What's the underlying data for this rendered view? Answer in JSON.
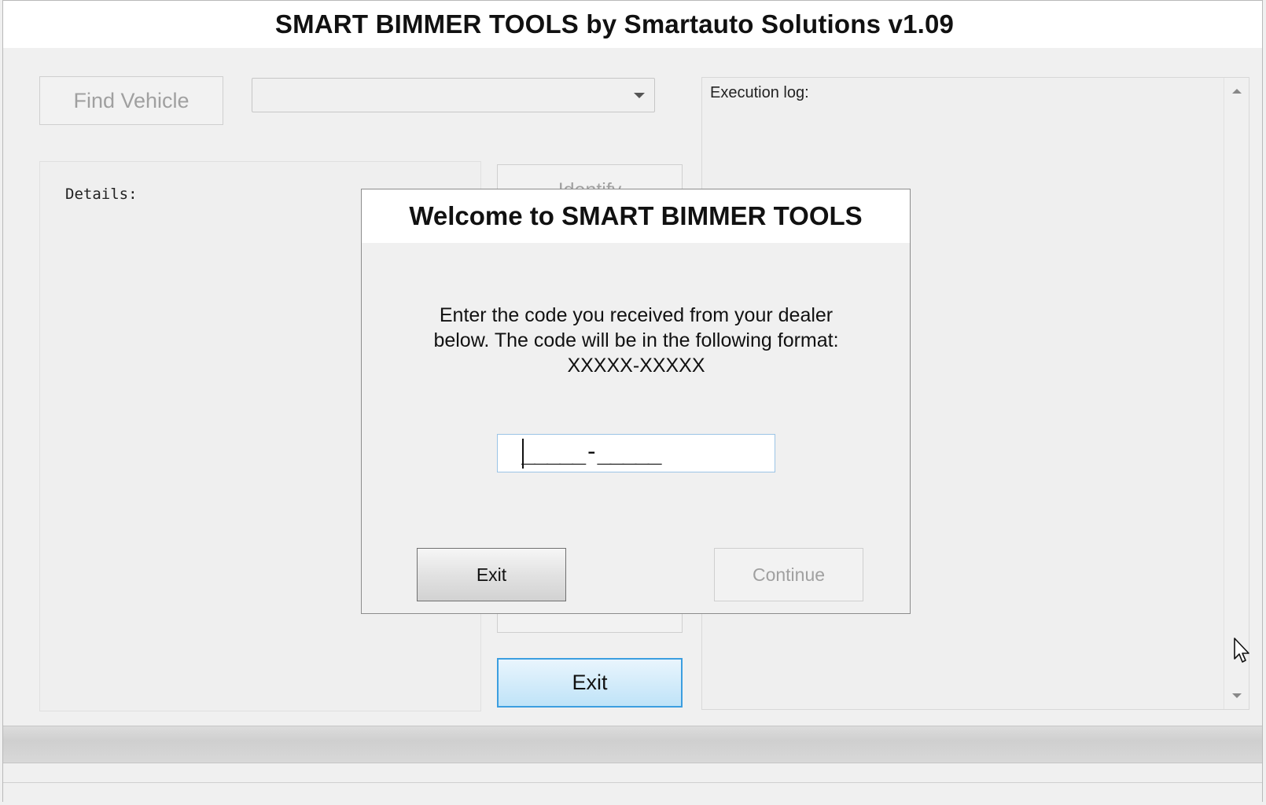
{
  "window": {
    "title": "SMART BIMMER TOOLS by Smartauto Solutions v1.09"
  },
  "toolbar": {
    "find_vehicle_label": "Find Vehicle",
    "vehicle_select_value": ""
  },
  "details": {
    "label": "Details:"
  },
  "actions": {
    "identify_label": "Identify",
    "exit_label": "Exit"
  },
  "log": {
    "label": "Execution log:"
  },
  "progress": {
    "value": 0
  },
  "dialog": {
    "title": "Welcome to SMART BIMMER TOOLS",
    "message_line1": "Enter the code you received from your dealer",
    "message_line2": "below. The code will be in the following format:",
    "message_line3": "XXXXX-XXXXX",
    "code_value": "",
    "code_mask": "_____-_____",
    "exit_label": "Exit",
    "continue_label": "Continue"
  },
  "colors": {
    "accent_border": "#3c9ee0",
    "accent_fill": "#bfe3f8",
    "disabled_text": "#a0a0a0"
  },
  "icons": {
    "dropdown": "chevron-down-icon",
    "scroll_up": "scroll-up-arrow-icon",
    "scroll_down": "scroll-down-arrow-icon",
    "cursor": "mouse-pointer-icon"
  }
}
